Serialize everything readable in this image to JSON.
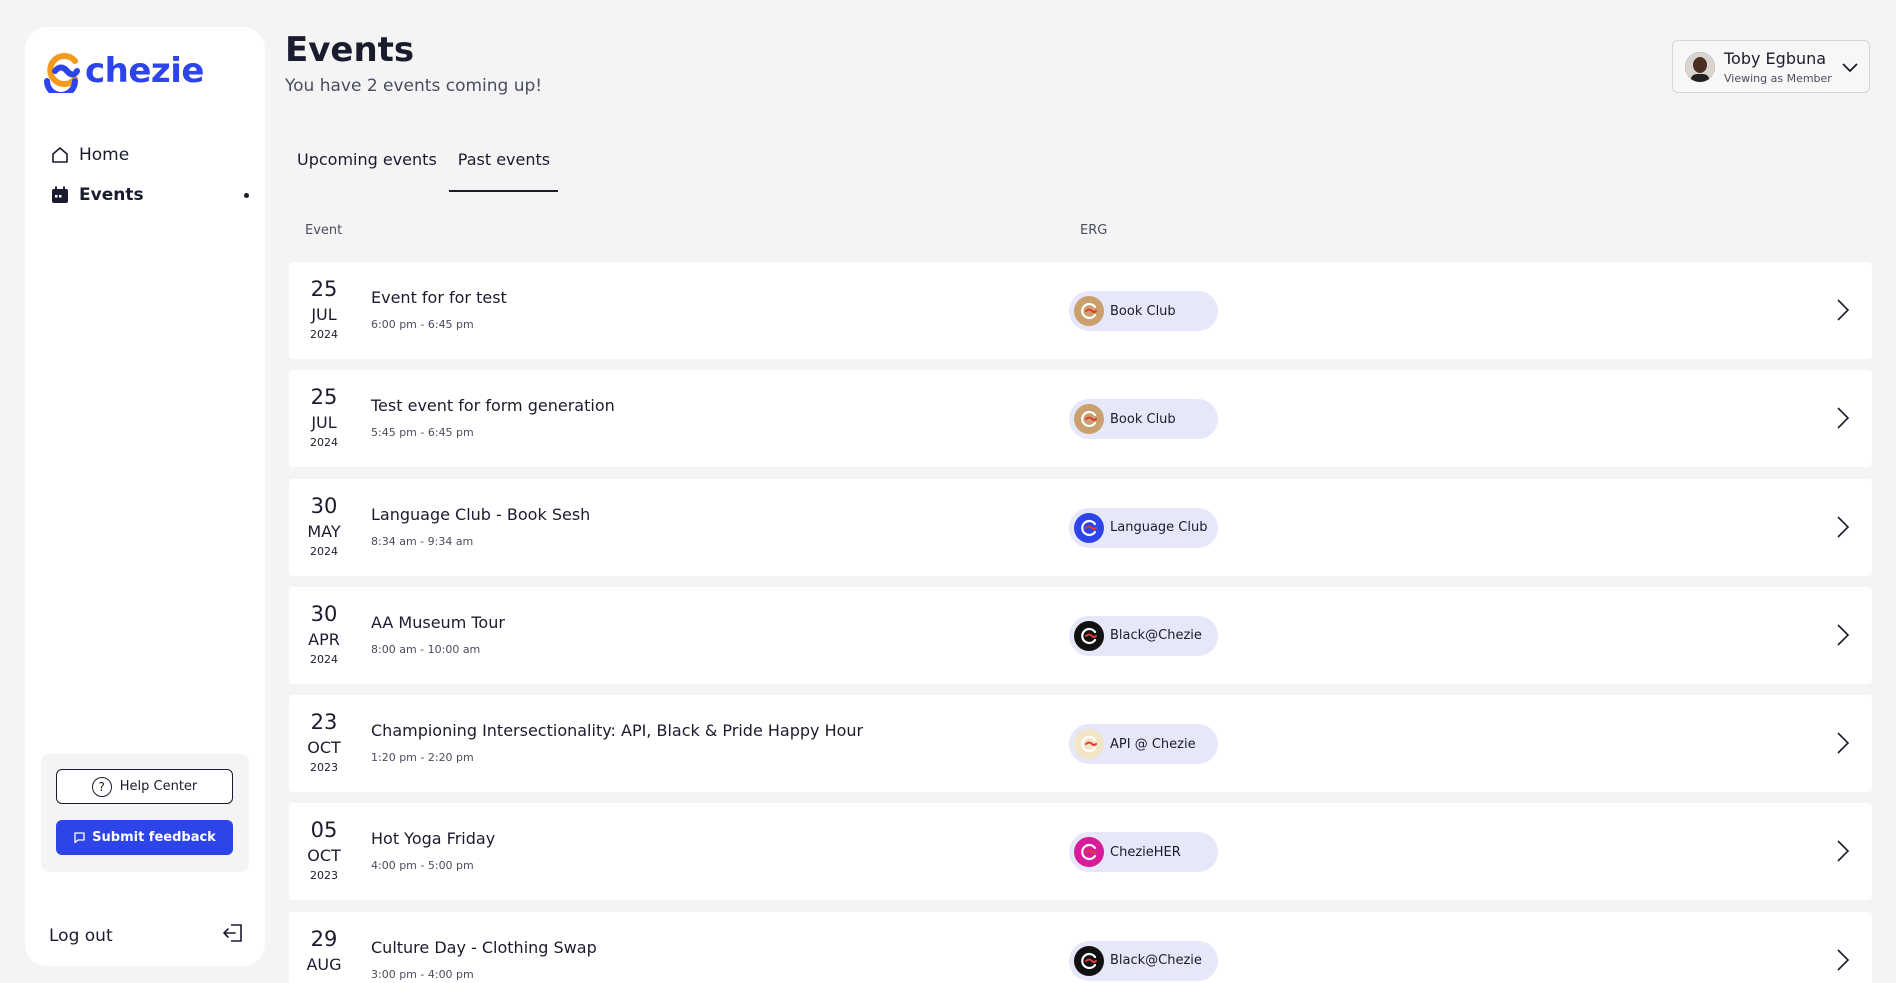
{
  "app": {
    "logo_text": "chezie",
    "brand_color": "#2d44e8"
  },
  "sidebar": {
    "nav": [
      {
        "label": "Home",
        "icon": "home-icon"
      },
      {
        "label": "Events",
        "icon": "calendar-icon",
        "active": true
      }
    ],
    "help_label": "Help Center",
    "feedback_label": "Submit feedback",
    "logout_label": "Log out"
  },
  "header": {
    "title": "Events",
    "subtitle": "You have 2 events coming up!"
  },
  "user": {
    "name": "Toby Egbuna",
    "role": "Viewing as Member"
  },
  "tabs": [
    {
      "label": "Upcoming events",
      "active": false
    },
    {
      "label": "Past events",
      "active": true
    }
  ],
  "table": {
    "columns": [
      "Event",
      "ERG"
    ],
    "rows": [
      {
        "day": "25",
        "month": "JUL",
        "year": "2024",
        "title": "Event for for test",
        "time": "6:00 pm - 6:45 pm",
        "erg": "Book Club",
        "erg_color": "#c9a06e"
      },
      {
        "day": "25",
        "month": "JUL",
        "year": "2024",
        "title": "Test event for form generation",
        "time": "5:45 pm - 6:45 pm",
        "erg": "Book Club",
        "erg_color": "#c9a06e"
      },
      {
        "day": "30",
        "month": "MAY",
        "year": "2024",
        "title": "Language Club - Book Sesh",
        "time": "8:34 am - 9:34 am",
        "erg": "Language Club",
        "erg_color": "#2d44e8"
      },
      {
        "day": "30",
        "month": "APR",
        "year": "2024",
        "title": "AA Museum Tour",
        "time": "8:00 am - 10:00 am",
        "erg": "Black@Chezie",
        "erg_color": "#111111"
      },
      {
        "day": "23",
        "month": "OCT",
        "year": "2023",
        "title": "Championing Intersectionality: API, Black & Pride Happy Hour",
        "time": "1:20 pm - 2:20 pm",
        "erg": "API @ Chezie",
        "erg_color": "#f3e5c8"
      },
      {
        "day": "05",
        "month": "OCT",
        "year": "2023",
        "title": "Hot Yoga Friday",
        "time": "4:00 pm - 5:00 pm",
        "erg": "ChezieHER",
        "erg_color": "#d81b9a"
      },
      {
        "day": "29",
        "month": "AUG",
        "year": "",
        "title": "Culture Day - Clothing Swap",
        "time": "3:00 pm - 4:00 pm",
        "erg": "Black@Chezie",
        "erg_color": "#111111"
      }
    ]
  }
}
